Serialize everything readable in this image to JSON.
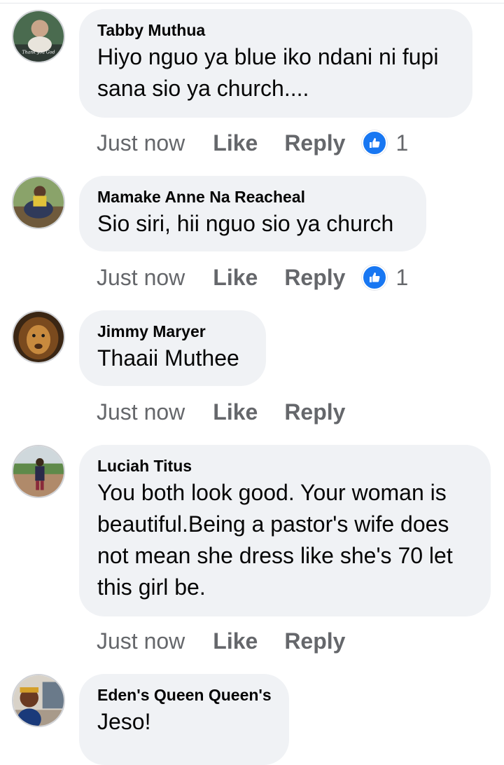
{
  "comments": [
    {
      "author": "Tabby Muthua",
      "text": "Hiyo nguo ya blue iko ndani ni fupi sana sio ya church....",
      "time": "Just now",
      "like_label": "Like",
      "reply_label": "Reply",
      "reaction_count": "1",
      "avatar_text": "Thank you God"
    },
    {
      "author": "Mamake Anne Na Reacheal",
      "text": "Sio siri, hii nguo sio ya church",
      "time": "Just now",
      "like_label": "Like",
      "reply_label": "Reply",
      "reaction_count": "1"
    },
    {
      "author": "Jimmy Maryer",
      "text": "Thaaii Muthee",
      "time": "Just now",
      "like_label": "Like",
      "reply_label": "Reply"
    },
    {
      "author": "Luciah Titus",
      "text": "You both look good. Your woman is beautiful.Being a pastor's wife does not mean she dress like she's 70 let this girl be.",
      "time": "Just now",
      "like_label": "Like",
      "reply_label": "Reply"
    },
    {
      "author": "Eden's Queen Queen's",
      "text": "Jeso!"
    }
  ],
  "colors": {
    "bubble": "#f0f2f5",
    "meta_text": "#65676b",
    "like_reaction": "#1877f2"
  },
  "icons": {
    "reaction": "thumbs-up-icon"
  }
}
